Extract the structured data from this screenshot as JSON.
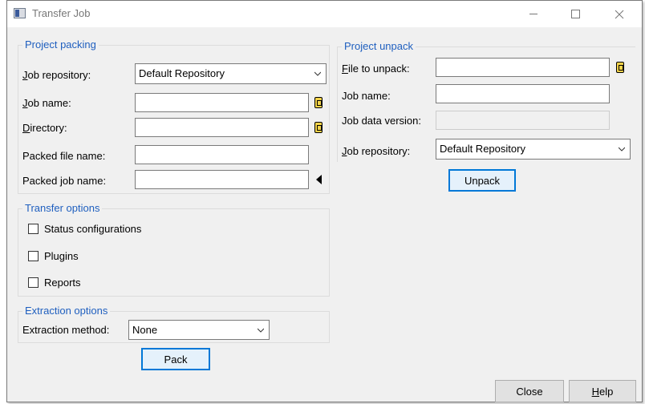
{
  "window": {
    "title": "Transfer Job"
  },
  "packing": {
    "group_label": "Project packing",
    "job_repository": {
      "label_key": "J",
      "label_rest": "ob repository:",
      "value": "Default Repository"
    },
    "job_name": {
      "label_key": "J",
      "label_rest": "ob name:",
      "value": ""
    },
    "directory": {
      "label_key": "D",
      "label_rest": "irectory:",
      "value": ""
    },
    "packed_file_name": {
      "label": "Packed file name:",
      "value": ""
    },
    "packed_job_name": {
      "label": "Packed job name:",
      "value": ""
    }
  },
  "transfer_options": {
    "group_label": "Transfer options",
    "items": [
      {
        "label": "Status configurations",
        "checked": false
      },
      {
        "label": "Plugins",
        "checked": false
      },
      {
        "label": "Reports",
        "checked": false
      }
    ]
  },
  "extraction_options": {
    "group_label": "Extraction options",
    "method_label": "Extraction method:",
    "method_value": "None"
  },
  "pack_button": "Pack",
  "unpack": {
    "group_label": "Project unpack",
    "file_to_unpack": {
      "label_key": "F",
      "label_rest": "ile to unpack:",
      "value": ""
    },
    "job_name": {
      "label": "Job name:",
      "value": ""
    },
    "job_data_version": {
      "label": "Job data version:",
      "value": ""
    },
    "job_repository": {
      "label_key": "J",
      "label_rest": "ob repository:",
      "value": "Default Repository"
    }
  },
  "unpack_button": "Unpack",
  "close_button": "Close",
  "help_button": {
    "key": "H",
    "rest": "elp"
  },
  "icons": {
    "app": "transfer-job-app-icon",
    "browse": "folder-browse-icon",
    "arrow": "left-arrow-icon",
    "dropdown": "chevron-down-icon"
  }
}
